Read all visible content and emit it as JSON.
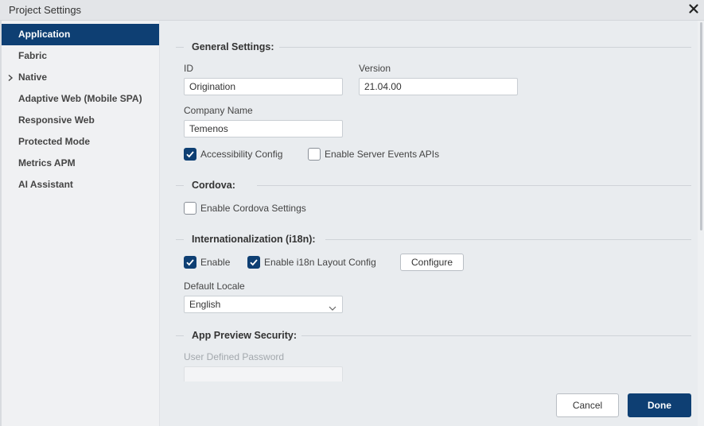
{
  "window": {
    "title": "Project Settings"
  },
  "sidebar": {
    "items": [
      {
        "label": "Application",
        "active": true,
        "expandable": false
      },
      {
        "label": "Fabric",
        "active": false,
        "expandable": false
      },
      {
        "label": "Native",
        "active": false,
        "expandable": true
      },
      {
        "label": "Adaptive Web (Mobile SPA)",
        "active": false,
        "expandable": false
      },
      {
        "label": "Responsive Web",
        "active": false,
        "expandable": false
      },
      {
        "label": "Protected Mode",
        "active": false,
        "expandable": false
      },
      {
        "label": "Metrics APM",
        "active": false,
        "expandable": false
      },
      {
        "label": "AI Assistant",
        "active": false,
        "expandable": false
      }
    ]
  },
  "general": {
    "heading": "General Settings:",
    "id_label": "ID",
    "id_value": "Origination",
    "version_label": "Version",
    "version_value": "21.04.00",
    "company_label": "Company Name",
    "company_value": "Temenos",
    "accessibility_label": "Accessibility Config",
    "accessibility_checked": true,
    "server_events_label": "Enable Server Events APIs",
    "server_events_checked": false
  },
  "cordova": {
    "heading": "Cordova:",
    "enable_label": "Enable Cordova Settings",
    "enable_checked": false
  },
  "i18n": {
    "heading": "Internationalization (i18n):",
    "enable_label": "Enable",
    "enable_checked": true,
    "layout_label": "Enable i18n Layout Config",
    "layout_checked": true,
    "configure_label": "Configure",
    "locale_label": "Default Locale",
    "locale_value": "English"
  },
  "preview": {
    "heading": "App Preview Security:",
    "password_label": "User Defined Password",
    "password_value": ""
  },
  "footer": {
    "cancel_label": "Cancel",
    "done_label": "Done"
  },
  "colors": {
    "accent": "#0e3f73",
    "background": "#e9ecef",
    "sidebar": "#f0f1f3"
  }
}
